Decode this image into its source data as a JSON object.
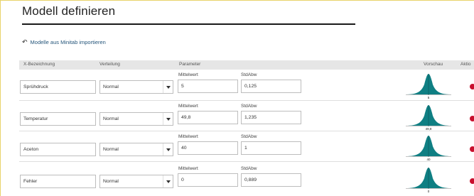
{
  "page": {
    "title": "Modell definieren",
    "import_link": "Modelle aus Minitab importieren"
  },
  "table": {
    "columns": {
      "name": "X-Bezeichnung",
      "distribution": "Verteilung",
      "parameter": "Parameter",
      "preview": "Vorschau",
      "actions": "Aktio"
    },
    "rows": [
      {
        "name": "Sprühdruck",
        "distribution": "Normal",
        "param1_label": "Mittelwert",
        "param1_value": "5",
        "param2_label": "StdAbw",
        "param2_value": "0,125",
        "preview_label": "5"
      },
      {
        "name": "Temperatur",
        "distribution": "Normal",
        "param1_label": "Mittelwert",
        "param1_value": "49,8",
        "param2_label": "StdAbw",
        "param2_value": "1,235",
        "preview_label": "49,8"
      },
      {
        "name": "Aceton",
        "distribution": "Normal",
        "param1_label": "Mittelwert",
        "param1_value": "40",
        "param2_label": "StdAbw",
        "param2_value": "1",
        "preview_label": "40"
      },
      {
        "name": "Fehler",
        "distribution": "Normal",
        "param1_label": "Mittelwert",
        "param1_value": "0",
        "param2_label": "StdAbw",
        "param2_value": "0,889",
        "preview_label": "0"
      }
    ]
  },
  "icons": {
    "import": "undo-arrow-icon",
    "dropdown": "chevron-down-icon",
    "delete": "delete-icon"
  },
  "colors": {
    "accent": "#24557a",
    "curve_fill": "#0f7f83",
    "delete": "#c8102e",
    "header_bg": "#e6e6e6",
    "frame_border": "#e8d36a"
  }
}
